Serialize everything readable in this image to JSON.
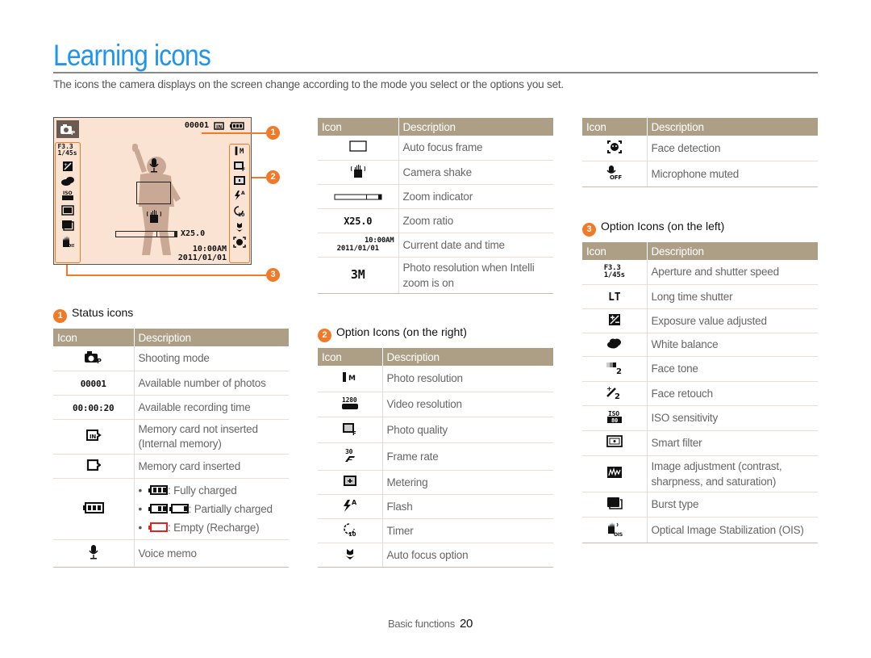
{
  "page": {
    "title": "Learning icons",
    "intro": "The icons the camera displays on the screen change according to the mode you select or the options you set."
  },
  "screen": {
    "photo_count": "00001",
    "zoom_ratio": "X25.0",
    "time": "10:00AM",
    "date": "2011/01/01",
    "aperture": "F3.3",
    "shutter": "1/45s",
    "callouts": [
      "1",
      "2",
      "3"
    ],
    "accent_color": "#f07a28"
  },
  "status_section": {
    "number": "1",
    "heading": "Status icons",
    "col_icon": "Icon",
    "col_desc": "Description",
    "rows": [
      {
        "icon": "camera-program-icon",
        "desc": "Shooting mode"
      },
      {
        "icon": "photo-count-icon",
        "icon_text": "00001",
        "desc": "Available number of photos"
      },
      {
        "icon": "recording-time-icon",
        "icon_text": "00:00:20",
        "desc": "Available recording time"
      },
      {
        "icon": "internal-memory-icon",
        "desc": "Memory card not inserted (Internal memory)"
      },
      {
        "icon": "memory-card-icon",
        "desc": "Memory card inserted"
      },
      {
        "icon": "battery-icon",
        "battery": [
          {
            "state": "full",
            "label": ": Fully charged"
          },
          {
            "state": "partial",
            "label": ": Partially charged"
          },
          {
            "state": "empty",
            "label": ": Empty (Recharge)"
          }
        ]
      },
      {
        "icon": "microphone-icon",
        "desc": "Voice memo"
      }
    ]
  },
  "middle_table": {
    "col_icon": "Icon",
    "col_desc": "Description",
    "rows": [
      {
        "icon": "af-frame-icon",
        "desc": "Auto focus frame"
      },
      {
        "icon": "camera-shake-icon",
        "desc": "Camera shake"
      },
      {
        "icon": "zoom-indicator-icon",
        "desc": "Zoom indicator"
      },
      {
        "icon": "zoom-ratio-icon",
        "icon_text": "X25.0",
        "desc": "Zoom ratio"
      },
      {
        "icon": "date-time-icon",
        "icon_text": "10:00AM",
        "icon_text2": "2011/01/01",
        "desc": "Current date and time"
      },
      {
        "icon": "intelli-zoom-resolution-icon",
        "icon_text": "3M",
        "desc": "Photo resolution when Intelli zoom is on"
      }
    ]
  },
  "right_options_section": {
    "number": "2",
    "heading": "Option Icons (on the right)",
    "col_icon": "Icon",
    "col_desc": "Description",
    "rows": [
      {
        "icon": "photo-resolution-icon",
        "desc": "Photo resolution"
      },
      {
        "icon": "video-resolution-icon",
        "desc": "Video resolution"
      },
      {
        "icon": "photo-quality-icon",
        "desc": "Photo quality"
      },
      {
        "icon": "frame-rate-icon",
        "desc": "Frame rate"
      },
      {
        "icon": "metering-icon",
        "desc": "Metering"
      },
      {
        "icon": "flash-icon",
        "desc": "Flash"
      },
      {
        "icon": "timer-icon",
        "desc": "Timer"
      },
      {
        "icon": "macro-flower-icon",
        "desc": "Auto focus option"
      }
    ]
  },
  "right_table_top": {
    "col_icon": "Icon",
    "col_desc": "Description",
    "rows": [
      {
        "icon": "face-detection-icon",
        "desc": "Face detection"
      },
      {
        "icon": "microphone-off-icon",
        "desc": "Microphone muted"
      }
    ]
  },
  "left_options_section": {
    "number": "3",
    "heading": "Option Icons (on the left)",
    "col_icon": "Icon",
    "col_desc": "Description",
    "rows": [
      {
        "icon": "aperture-shutter-icon",
        "icon_text": "F3.3",
        "icon_text2": "1/45s",
        "desc": "Aperture and shutter speed"
      },
      {
        "icon": "long-time-shutter-icon",
        "icon_text": "LT",
        "desc": "Long time shutter"
      },
      {
        "icon": "exposure-icon",
        "desc": "Exposure value adjusted"
      },
      {
        "icon": "white-balance-icon",
        "desc": "White balance"
      },
      {
        "icon": "face-tone-icon",
        "desc": "Face tone"
      },
      {
        "icon": "face-retouch-icon",
        "desc": "Face retouch"
      },
      {
        "icon": "iso-icon",
        "desc": "ISO sensitivity"
      },
      {
        "icon": "smart-filter-icon",
        "desc": "Smart filter"
      },
      {
        "icon": "image-adjust-icon",
        "desc": "Image adjustment (contrast, sharpness, and saturation)"
      },
      {
        "icon": "burst-icon",
        "desc": "Burst type"
      },
      {
        "icon": "ois-icon",
        "desc": "Optical Image Stabilization (OIS)"
      }
    ]
  },
  "footer": {
    "section": "Basic functions",
    "page_number": "20"
  }
}
